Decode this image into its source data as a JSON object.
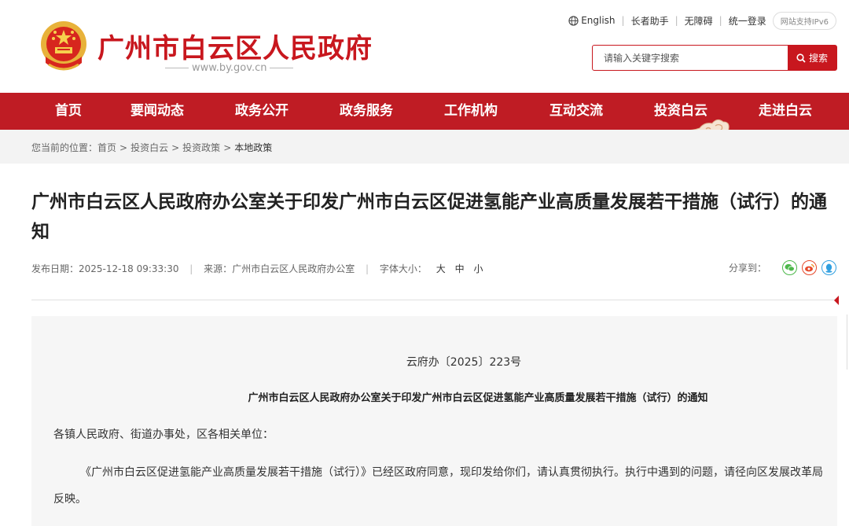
{
  "header": {
    "site_title": "广州市白云区人民政府",
    "site_url": "www.by.gov.cn",
    "top_links": {
      "english": "English",
      "elder_helper": "长者助手",
      "accessibility": "无障碍",
      "unified_login": "统一登录",
      "ipv6": "网站支持IPv6"
    },
    "search": {
      "placeholder": "请输入关键字搜索",
      "button_label": "搜索"
    }
  },
  "nav": {
    "items": [
      {
        "label": "首页"
      },
      {
        "label": "要闻动态"
      },
      {
        "label": "政务公开"
      },
      {
        "label": "政务服务"
      },
      {
        "label": "工作机构"
      },
      {
        "label": "互动交流"
      },
      {
        "label": "投资白云"
      },
      {
        "label": "走进白云"
      }
    ],
    "active": "投资白云"
  },
  "breadcrumb": {
    "prefix": "您当前的位置：",
    "items": [
      "首页",
      "投资白云",
      "投资政策"
    ],
    "current": "本地政策"
  },
  "article": {
    "title": "广州市白云区人民政府办公室关于印发广州市白云区促进氢能产业高质量发展若干措施（试行）的通知",
    "meta": {
      "publish_label": "发布日期：",
      "publish_date": "2025-12-18 09:33:30",
      "source_label": "来源：",
      "source": "广州市白云区人民政府办公室",
      "font_size_label": "字体大小：",
      "font_sizes": [
        "大",
        "中",
        "小"
      ]
    },
    "share_label": "分享到：",
    "share_icons": [
      "wechat-icon",
      "weibo-icon",
      "qq-icon"
    ],
    "doc_number": "云府办〔2025〕223号",
    "doc_title": "广州市白云区人民政府办公室关于印发广州市白云区促进氢能产业高质量发展若干措施（试行）的通知",
    "salutation": "各镇人民政府、街道办事处，区各相关单位：",
    "body_paragraph": "《广州市白云区促进氢能产业高质量发展若干措施（试行）》已经区政府同意，现印发给你们，请认真贯彻执行。执行中遇到的问题，请径向区发展改革局反映。"
  },
  "colors": {
    "brand_red": "#c8171e",
    "nav_red": "#bf1c24",
    "crumb_bg": "#f3f3f3",
    "content_bg": "#f6f6f6"
  }
}
